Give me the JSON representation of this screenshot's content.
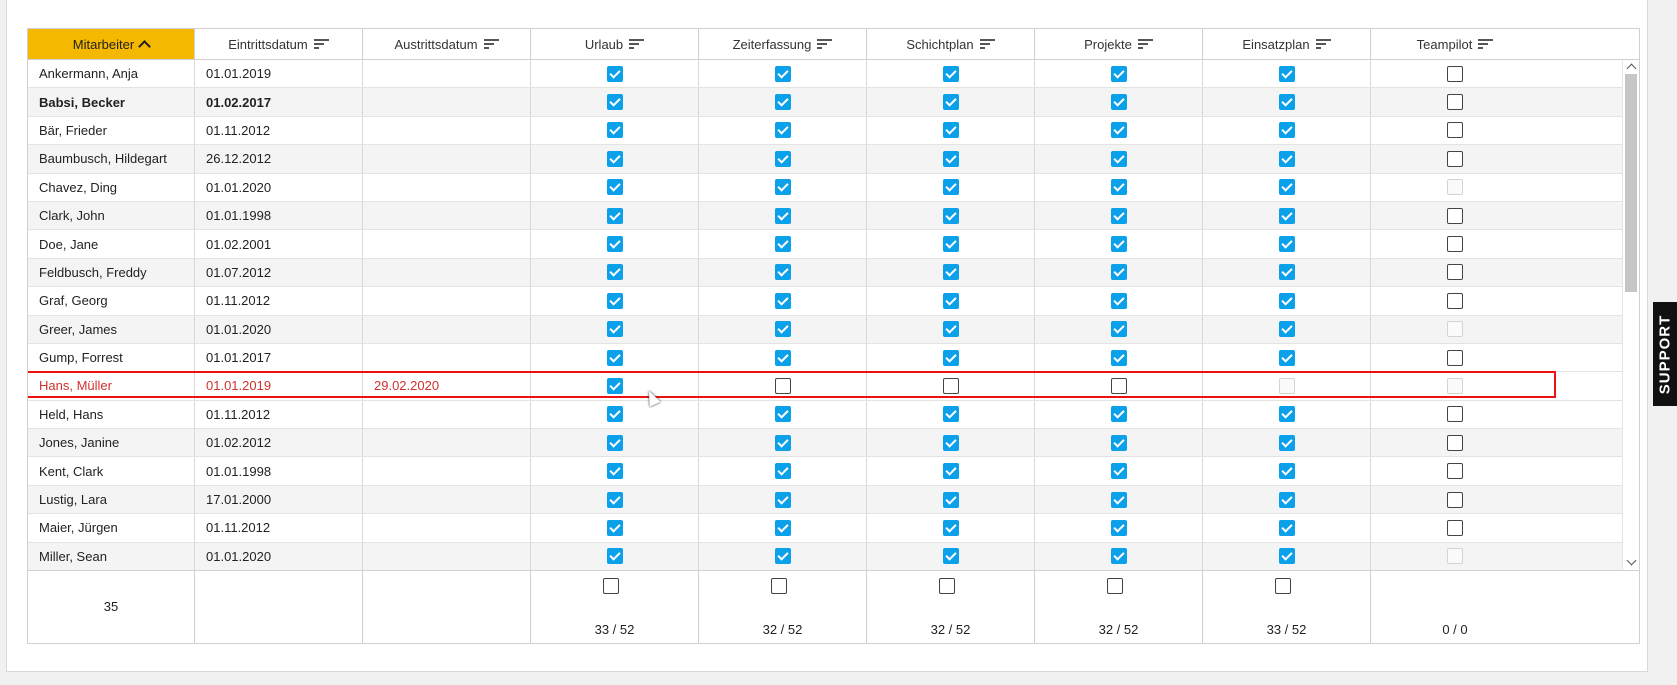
{
  "columns": [
    {
      "label": "Mitarbeiter",
      "sorted": true
    },
    {
      "label": "Eintrittsdatum",
      "sorted": false
    },
    {
      "label": "Austrittsdatum",
      "sorted": false
    },
    {
      "label": "Urlaub",
      "sorted": false
    },
    {
      "label": "Zeiterfassung",
      "sorted": false
    },
    {
      "label": "Schichtplan",
      "sorted": false
    },
    {
      "label": "Projekte",
      "sorted": false
    },
    {
      "label": "Einsatzplan",
      "sorted": false
    },
    {
      "label": "Teampilot",
      "sorted": false
    }
  ],
  "rows": [
    {
      "name": "Ankermann, Anja",
      "start": "01.01.2019",
      "end": "",
      "checks": [
        "on",
        "on",
        "on",
        "on",
        "on",
        "off"
      ]
    },
    {
      "name": "Babsi, Becker",
      "start": "01.02.2017",
      "end": "",
      "bold": true,
      "checks": [
        "on",
        "on",
        "on",
        "on",
        "on",
        "off"
      ]
    },
    {
      "name": "Bär, Frieder",
      "start": "01.11.2012",
      "end": "",
      "checks": [
        "on",
        "on",
        "on",
        "on",
        "on",
        "off"
      ]
    },
    {
      "name": "Baumbusch, Hildegart",
      "start": "26.12.2012",
      "end": "",
      "checks": [
        "on",
        "on",
        "on",
        "on",
        "on",
        "off"
      ]
    },
    {
      "name": "Chavez, Ding",
      "start": "01.01.2020",
      "end": "",
      "checks": [
        "on",
        "on",
        "on",
        "on",
        "on",
        "dis"
      ]
    },
    {
      "name": "Clark, John",
      "start": "01.01.1998",
      "end": "",
      "checks": [
        "on",
        "on",
        "on",
        "on",
        "on",
        "off"
      ]
    },
    {
      "name": "Doe, Jane",
      "start": "01.02.2001",
      "end": "",
      "checks": [
        "on",
        "on",
        "on",
        "on",
        "on",
        "off"
      ]
    },
    {
      "name": "Feldbusch, Freddy",
      "start": "01.07.2012",
      "end": "",
      "checks": [
        "on",
        "on",
        "on",
        "on",
        "on",
        "off"
      ]
    },
    {
      "name": "Graf, Georg",
      "start": "01.11.2012",
      "end": "",
      "checks": [
        "on",
        "on",
        "on",
        "on",
        "on",
        "off"
      ]
    },
    {
      "name": "Greer, James",
      "start": "01.01.2020",
      "end": "",
      "checks": [
        "on",
        "on",
        "on",
        "on",
        "on",
        "dis"
      ]
    },
    {
      "name": "Gump, Forrest",
      "start": "01.01.2017",
      "end": "",
      "checks": [
        "on",
        "on",
        "on",
        "on",
        "on",
        "off"
      ]
    },
    {
      "name": "Hans, Müller",
      "start": "01.01.2019",
      "end": "29.02.2020",
      "alert": true,
      "checks": [
        "on",
        "off",
        "off",
        "off",
        "dis",
        "dis"
      ]
    },
    {
      "name": "Held, Hans",
      "start": "01.11.2012",
      "end": "",
      "checks": [
        "on",
        "on",
        "on",
        "on",
        "on",
        "off"
      ]
    },
    {
      "name": "Jones, Janine",
      "start": "01.02.2012",
      "end": "",
      "checks": [
        "on",
        "on",
        "on",
        "on",
        "on",
        "off"
      ]
    },
    {
      "name": "Kent, Clark",
      "start": "01.01.1998",
      "end": "",
      "checks": [
        "on",
        "on",
        "on",
        "on",
        "on",
        "off"
      ]
    },
    {
      "name": "Lustig, Lara",
      "start": "17.01.2000",
      "end": "",
      "checks": [
        "on",
        "on",
        "on",
        "on",
        "on",
        "off"
      ]
    },
    {
      "name": "Maier, Jürgen",
      "start": "01.11.2012",
      "end": "",
      "checks": [
        "on",
        "on",
        "on",
        "on",
        "on",
        "off"
      ]
    },
    {
      "name": "Miller, Sean",
      "start": "01.01.2020",
      "end": "",
      "checks": [
        "on",
        "on",
        "on",
        "on",
        "on",
        "dis"
      ]
    }
  ],
  "footer": {
    "count": "35",
    "ratios": [
      "33 / 52",
      "32 / 52",
      "32 / 52",
      "32 / 52",
      "33 / 52",
      "0 / 0"
    ]
  },
  "support_label": "SUPPORT",
  "colors": {
    "accent": "#f5b800",
    "checkbox": "#0aa0ea",
    "alert": "#d0312d"
  }
}
